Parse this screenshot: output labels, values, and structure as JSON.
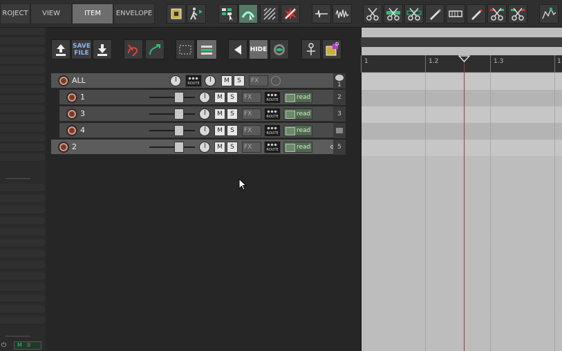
{
  "menu": {
    "tabs": [
      {
        "label": "ROJECT"
      },
      {
        "label": "VIEW"
      },
      {
        "label": "ITEM"
      },
      {
        "label": "ENVELOPE"
      }
    ],
    "active_tab": "ITEM"
  },
  "mcp_toolbar": {
    "save_file_label_1": "SAVE",
    "save_file_label_2": "FILE",
    "hide_label": "HIDE",
    "d_label": "D"
  },
  "tracks": [
    {
      "name": "ALL",
      "num": "1",
      "master": true
    },
    {
      "name": "1",
      "num": "2",
      "automation": "read"
    },
    {
      "name": "3",
      "num": "3",
      "automation": "read"
    },
    {
      "name": "4",
      "num": "",
      "automation": "read"
    },
    {
      "name": "2",
      "num": "5",
      "automation": "read"
    }
  ],
  "buttons": {
    "mute": "M",
    "solo": "S",
    "fx": "FX",
    "route": "ROUTE"
  },
  "ruler": {
    "marks": [
      "1",
      "1.2",
      "1.3",
      "1"
    ]
  },
  "status": {
    "m": "M",
    "b": "B"
  },
  "colors": {
    "accent": "#2cc07a",
    "cursor": "#aa3333",
    "arrange_bg": "#bdbdbd"
  }
}
